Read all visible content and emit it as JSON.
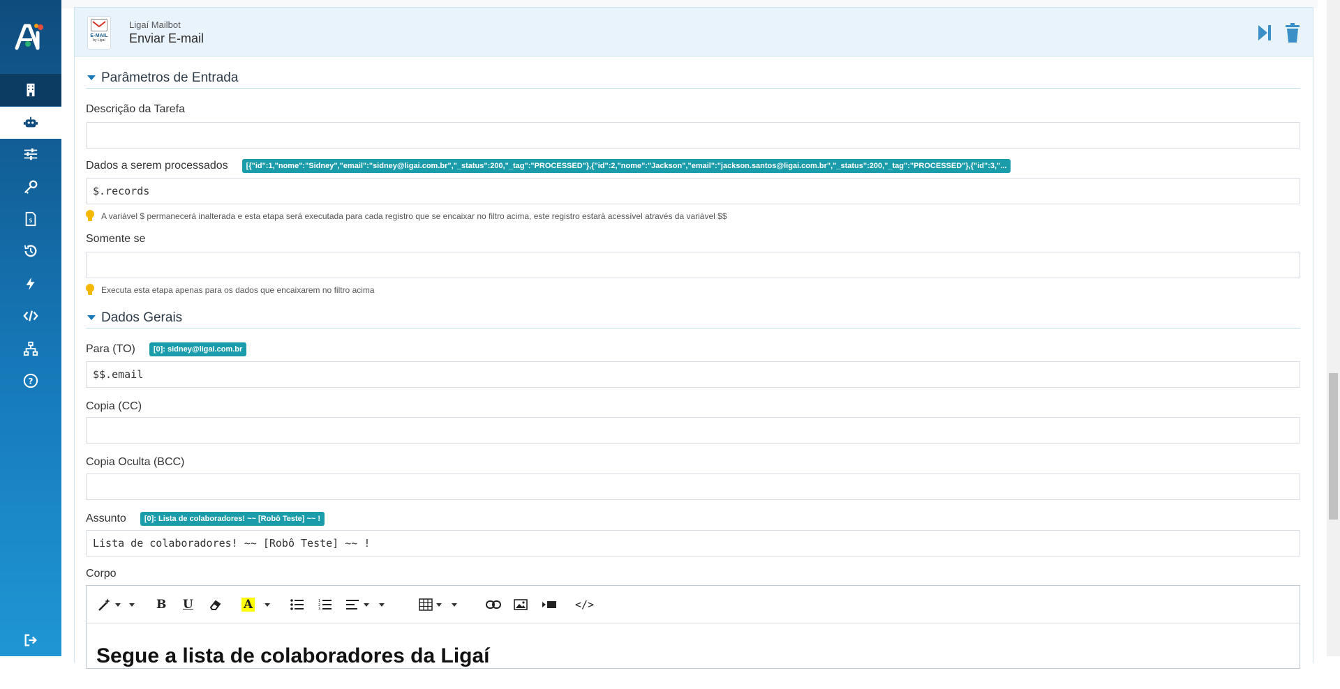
{
  "sidebar": {
    "logo": "AI",
    "items": [
      {
        "icon": "building-icon",
        "name": "sidebar-item-company"
      },
      {
        "icon": "robot-icon",
        "name": "sidebar-item-robots"
      },
      {
        "icon": "sliders-icon",
        "name": "sidebar-item-settings"
      },
      {
        "icon": "key-icon",
        "name": "sidebar-item-credentials"
      },
      {
        "icon": "invoice-icon",
        "name": "sidebar-item-billing"
      },
      {
        "icon": "history-icon",
        "name": "sidebar-item-history"
      },
      {
        "icon": "bolt-icon",
        "name": "sidebar-item-triggers"
      },
      {
        "icon": "code-icon",
        "name": "sidebar-item-api"
      },
      {
        "icon": "network-icon",
        "name": "sidebar-item-network"
      },
      {
        "icon": "help-icon",
        "name": "sidebar-item-help"
      },
      {
        "icon": "logout-icon",
        "name": "sidebar-item-logout"
      }
    ]
  },
  "step": {
    "badge_text": "E-MAIL",
    "badge_by": "by Ligaí",
    "subtitle": "Ligaí Mailbot",
    "title": "Enviar E-mail"
  },
  "sections": {
    "input_params": "Parâmetros de Entrada",
    "general": "Dados Gerais"
  },
  "fields": {
    "task_description": {
      "label": "Descrição da Tarefa",
      "value": ""
    },
    "data": {
      "label": "Dados a serem processados",
      "preview": "[{\"id\":1,\"nome\":\"Sidney\",\"email\":\"sidney@ligai.com.br\",\"_status\":200,\"_tag\":\"PROCESSED\"},{\"id\":2,\"nome\":\"Jackson\",\"email\":\"jackson.santos@ligai.com.br\",\"_status\":200,\"_tag\":\"PROCESSED\"},{\"id\":3,\"...",
      "value": "$.records",
      "hint": "A variável $ permanecerá inalterada e esta etapa será executada para cada registro que se encaixar no filtro acima, este registro estará acessível através da variável $$"
    },
    "only_if": {
      "label": "Somente se",
      "value": "",
      "hint": "Executa esta etapa apenas para os dados que encaixarem no filtro acima"
    },
    "to": {
      "label": "Para (TO)",
      "preview": "[0]: sidney@ligai.com.br",
      "value": "$$.email"
    },
    "cc": {
      "label": "Copia (CC)",
      "value": ""
    },
    "bcc": {
      "label": "Copia Oculta (BCC)",
      "value": ""
    },
    "subject": {
      "label": "Assunto",
      "preview": "[0]: Lista de colaboradores! ~~ [Robô Teste] ~~ !",
      "value": "Lista de colaboradores! ~~ [Robô Teste] ~~ !"
    },
    "body": {
      "label": "Corpo",
      "content_preview": "Segue a lista de colaboradores da Ligaí"
    }
  },
  "toolbar": {
    "bold": "B",
    "underline": "U",
    "font_color": "A",
    "code_view": "</>"
  },
  "colors": {
    "accent": "#1a78b8",
    "chip": "#1b9cab",
    "header_bg": "#e8f3fb"
  }
}
